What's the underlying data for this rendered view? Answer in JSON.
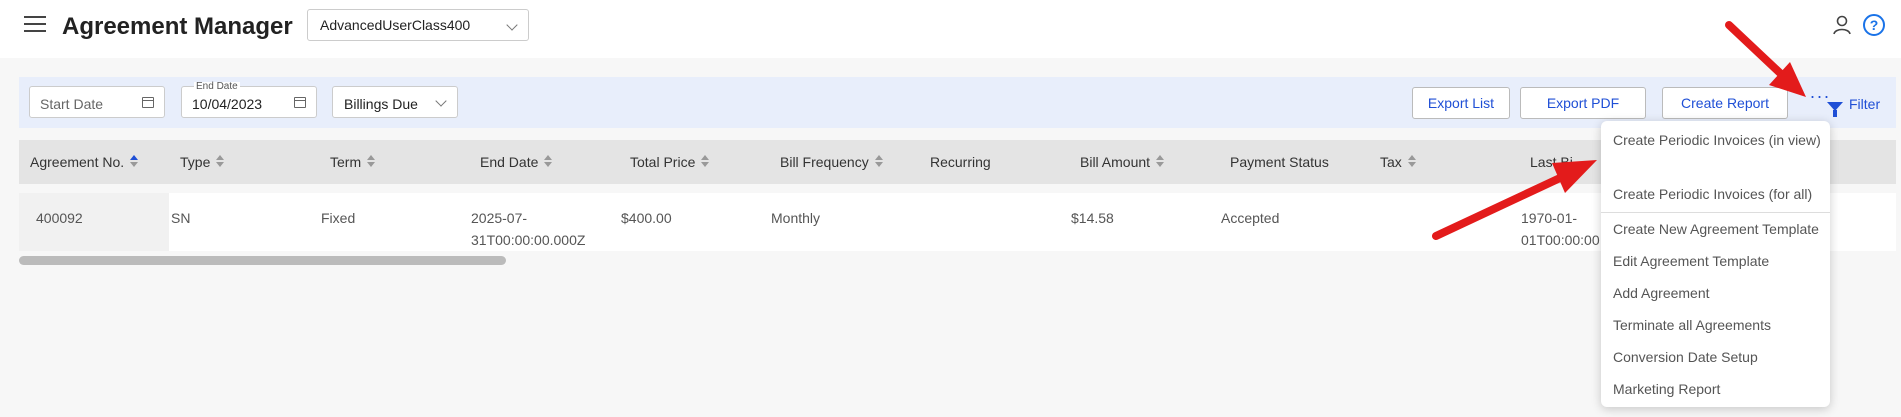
{
  "header": {
    "title": "Agreement Manager",
    "account_select": "AdvancedUserClass400"
  },
  "filters": {
    "start_date_placeholder": "Start Date",
    "end_date_label": "End Date",
    "end_date_value": "10/04/2023",
    "status_select": "Billings Due"
  },
  "toolbar": {
    "export_list": "Export List",
    "export_pdf": "Export PDF",
    "create_report": "Create Report",
    "more": "···",
    "filter": "Filter"
  },
  "table": {
    "columns": [
      "Agreement No.",
      "Type",
      "Term",
      "End Date",
      "Total Price",
      "Bill Frequency",
      "Recurring",
      "Bill Amount",
      "Payment Status",
      "Tax",
      "Last Billing"
    ],
    "visible_last_column": "Last Bi",
    "rows": [
      {
        "agreement_no": "400092",
        "type": "SN",
        "term": "Fixed",
        "end_date": "2025-07-31T00:00:00.000Z",
        "end_date_line1": "2025-07-",
        "end_date_line2": "31T00:00:00.000Z",
        "total_price": "$400.00",
        "bill_frequency": "Monthly",
        "recurring": "",
        "bill_amount": "$14.58",
        "payment_status": "Accepted",
        "tax": "",
        "last_billing_line1": "1970-01-",
        "last_billing_line2": "01T00:00:00"
      }
    ]
  },
  "more_menu": {
    "items": [
      "Create Periodic Invoices (in view)",
      "Create Periodic Invoices (for all)",
      "Create New Agreement Template",
      "Edit Agreement Template",
      "Add Agreement",
      "Terminate all Agreements",
      "Conversion Date Setup",
      "Marketing Report"
    ]
  },
  "colors": {
    "accent": "#1f4fd6",
    "filterbar_bg": "#e8eefb",
    "annotation_arrow": "#e31b1b"
  },
  "icons": {
    "menu": "hamburger-icon",
    "user": "user-icon",
    "help": "help-icon",
    "calendar": "calendar-icon",
    "filter": "funnel-icon"
  }
}
